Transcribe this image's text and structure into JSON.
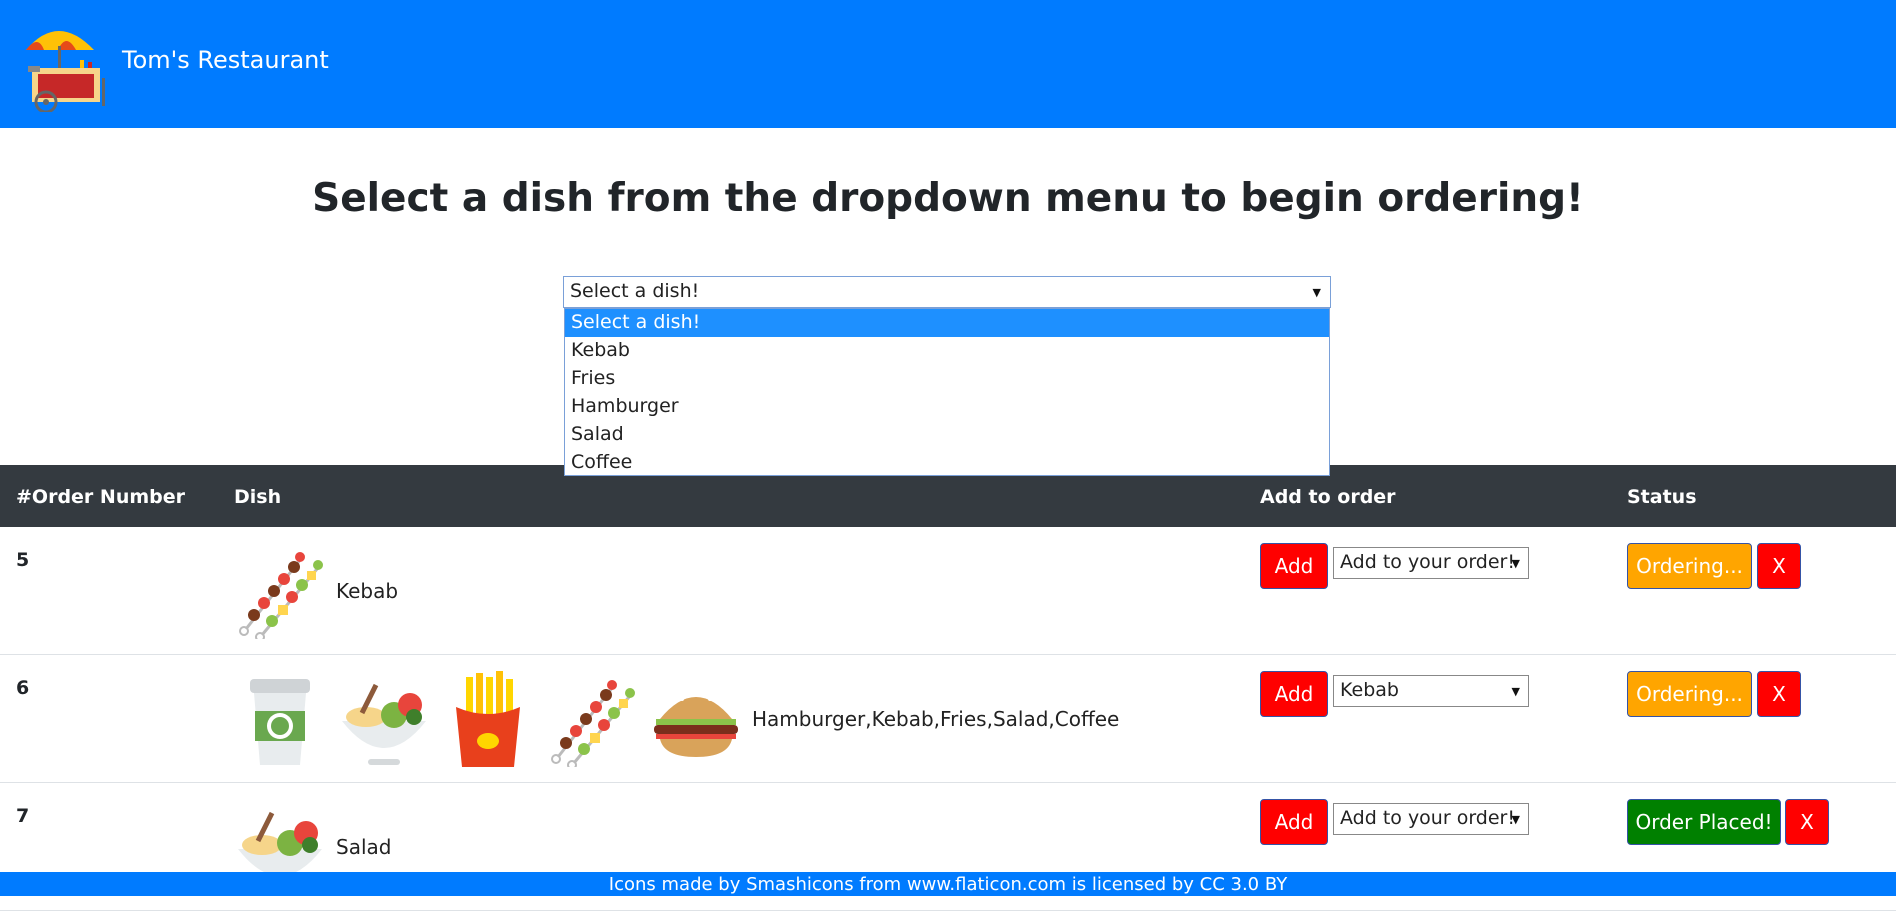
{
  "navbar": {
    "brand": "Tom's Restaurant",
    "logo_icon": "food-cart-umbrella-icon",
    "background": "#007bff"
  },
  "main": {
    "heading": "Select a dish from the dropdown menu to begin ordering!",
    "dish_select": {
      "value": "Select a dish!",
      "options": [
        "Select a dish!",
        "Kebab",
        "Fries",
        "Hamburger",
        "Salad",
        "Coffee"
      ],
      "highlighted_option": "Select a dish!"
    }
  },
  "table": {
    "headers": [
      "#Order Number",
      "Dish",
      "Add to order",
      "Status"
    ],
    "rows": [
      {
        "order_number": "5",
        "dish_icons": [
          "kebab-icon"
        ],
        "dishes": "Kebab",
        "add_label": "Add",
        "add_select": "Add to your order!",
        "status": "Ordering...",
        "status_color": "#ffa500",
        "remove_label": "X"
      },
      {
        "order_number": "6",
        "dish_icons": [
          "coffee-icon",
          "salad-icon",
          "fries-icon",
          "kebab-icon",
          "hamburger-icon"
        ],
        "dishes": "Hamburger,Kebab,Fries,Salad,Coffee",
        "add_label": "Add",
        "add_select": "Kebab",
        "status": "Ordering...",
        "status_color": "#ffa500",
        "remove_label": "X"
      },
      {
        "order_number": "7",
        "dish_icons": [
          "salad-icon"
        ],
        "dishes": "Salad",
        "add_label": "Add",
        "add_select": "Add to your order!",
        "status": "Order Placed!",
        "status_color": "#008000",
        "remove_label": "X"
      }
    ]
  },
  "footer": {
    "text": "Icons made by Smashicons from www.flaticon.com is licensed by CC 3.0 BY"
  }
}
